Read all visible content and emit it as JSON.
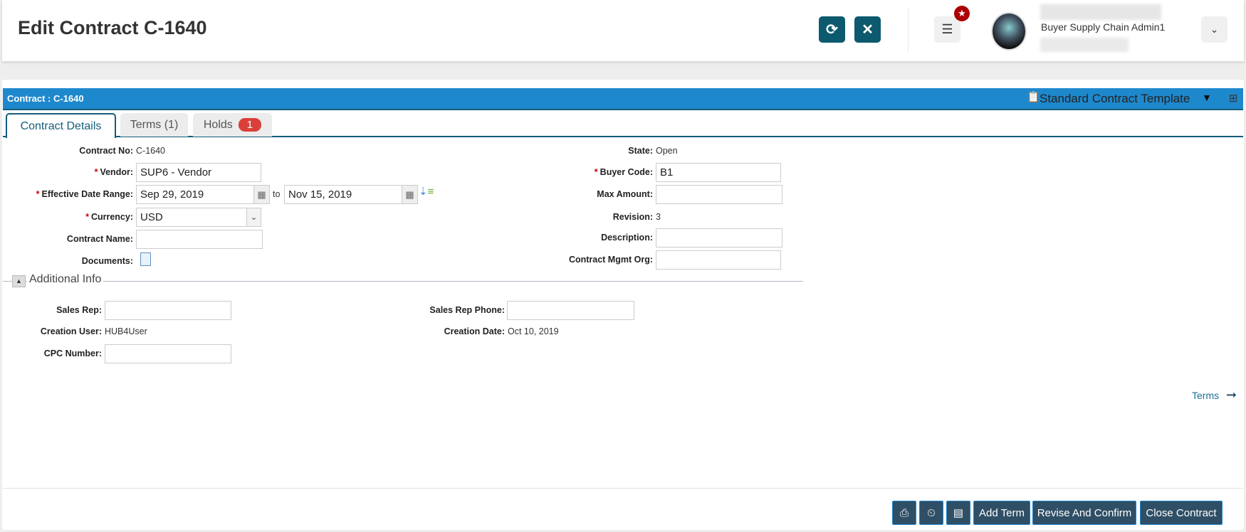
{
  "header": {
    "title": "Edit Contract C-1640",
    "user_role": "Buyer Supply Chain Admin1",
    "colors": {
      "accent": "#0d5a6e",
      "bar": "#1e88cd",
      "badge": "#d9403a"
    }
  },
  "panel": {
    "title": "Contract : C-1640",
    "template": "Standard Contract Template"
  },
  "tabs": [
    {
      "label": "Contract Details"
    },
    {
      "label": "Terms (1)"
    },
    {
      "label": "Holds",
      "badge": "1"
    }
  ],
  "form": {
    "contract_no": {
      "label": "Contract No:",
      "value": "C-1640"
    },
    "vendor": {
      "label": "Vendor:",
      "value": "SUP6 - Vendor"
    },
    "date_range": {
      "label": "Effective Date Range:",
      "from": "Sep 29, 2019",
      "to_label": "to",
      "to": "Nov 15, 2019"
    },
    "currency": {
      "label": "Currency:",
      "value": "USD"
    },
    "contract_name": {
      "label": "Contract Name:",
      "value": ""
    },
    "documents": {
      "label": "Documents:"
    },
    "state": {
      "label": "State:",
      "value": "Open"
    },
    "buyer_code": {
      "label": "Buyer Code:",
      "value": "B1"
    },
    "max_amount": {
      "label": "Max Amount:",
      "value": ""
    },
    "revision": {
      "label": "Revision:",
      "value": "3"
    },
    "description": {
      "label": "Description:",
      "value": ""
    },
    "mgmt_org": {
      "label": "Contract Mgmt Org:",
      "value": ""
    },
    "required_mark": "*"
  },
  "additional": {
    "title": "Additional Info",
    "sales_rep": {
      "label": "Sales Rep:",
      "value": ""
    },
    "sales_rep_phone": {
      "label": "Sales Rep Phone:",
      "value": ""
    },
    "creation_user": {
      "label": "Creation User:",
      "value": "HUB4User"
    },
    "creation_date": {
      "label": "Creation Date:",
      "value": "Oct 10, 2019"
    },
    "cpc_number": {
      "label": "CPC Number:",
      "value": ""
    }
  },
  "nav": {
    "terms_link": "Terms"
  },
  "footer": {
    "add_term": "Add Term",
    "revise": "Revise And Confirm",
    "close": "Close Contract"
  }
}
